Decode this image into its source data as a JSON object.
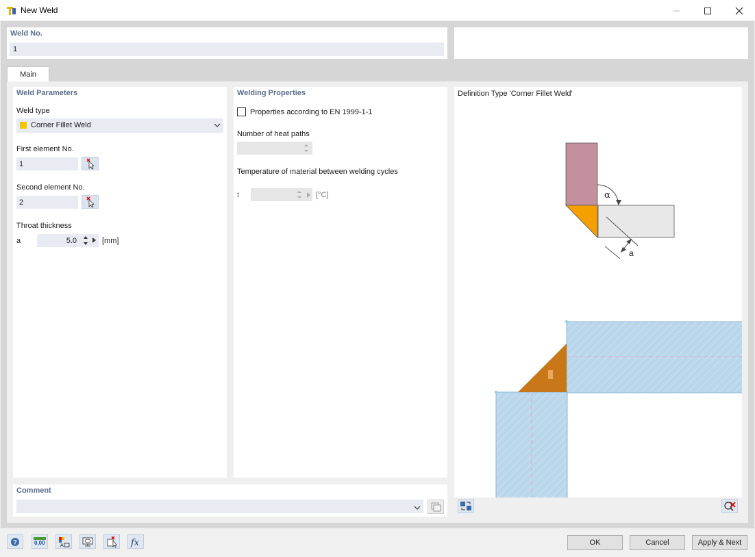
{
  "window": {
    "title": "New Weld"
  },
  "weld_no": {
    "label": "Weld No.",
    "value": "1"
  },
  "tabs": [
    {
      "label": "Main"
    }
  ],
  "weld_parameters": {
    "title": "Weld Parameters",
    "weld_type_label": "Weld type",
    "weld_type_value": "Corner Fillet Weld",
    "weld_type_color": "#f5c400",
    "first_element_label": "First element No.",
    "first_element_value": "1",
    "second_element_label": "Second element No.",
    "second_element_value": "2",
    "throat_label": "Throat thickness",
    "throat_symbol": "a",
    "throat_value": "5.0",
    "throat_unit": "[mm]"
  },
  "welding_properties": {
    "title": "Welding Properties",
    "en_checkbox_label": "Properties according to EN 1999-1-1",
    "en_checked": false,
    "heat_paths_label": "Number of heat paths",
    "heat_paths_value": "",
    "temperature_label": "Temperature of material between welding cycles",
    "temp_symbol": "t",
    "temp_value": "",
    "temp_unit": "[°C]"
  },
  "definition": {
    "title": "Definition Type 'Corner Fillet Weld'",
    "alpha_label": "α",
    "a_label": "a"
  },
  "comment": {
    "label": "Comment",
    "value": ""
  },
  "buttons": {
    "ok": "OK",
    "cancel": "Cancel",
    "apply_next": "Apply & Next"
  },
  "toolbar": {
    "units_text": "0,00"
  },
  "colors": {
    "accent_title": "#5a6e8c",
    "weld_orange": "#f5a000",
    "preview_weld": "#c87818",
    "preview_plate": "#b9d6ea",
    "plate_mauve": "#c4909e"
  }
}
